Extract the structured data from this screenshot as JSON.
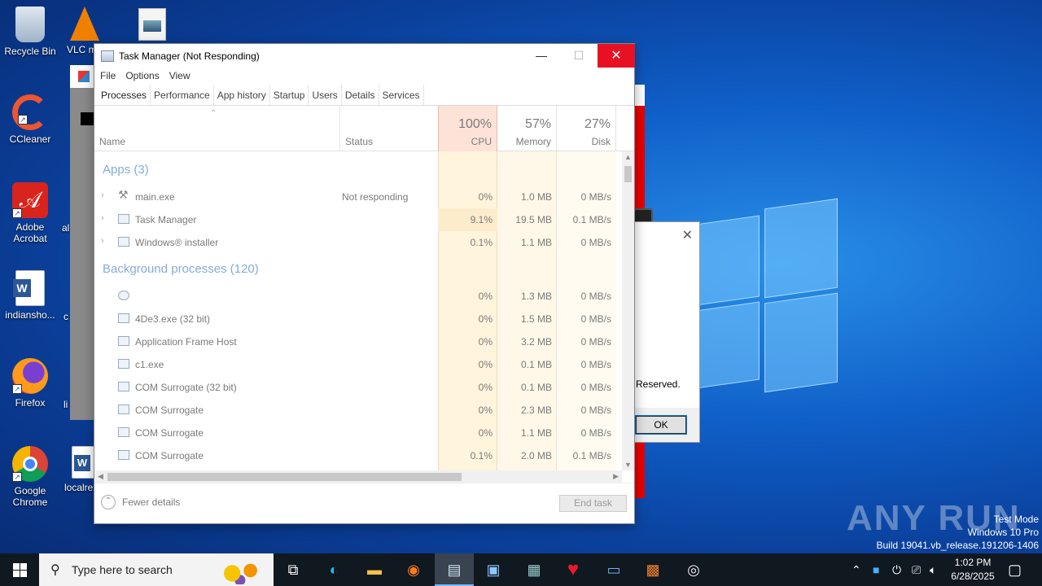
{
  "desktop": {
    "icons": [
      {
        "label": "Recycle Bin"
      },
      {
        "label": "VLC m"
      },
      {
        "label": "CCleaner"
      },
      {
        "label": "Adobe Acrobat"
      },
      {
        "label": "indiansho..."
      },
      {
        "label": "Firefox"
      },
      {
        "label": "Google Chrome"
      },
      {
        "label": "localre"
      },
      {
        "label": "al"
      },
      {
        "label": "c"
      },
      {
        "label": "li"
      }
    ]
  },
  "dialog": {
    "text": "Reserved.",
    "ok_label": "OK",
    "close_glyph": "✕"
  },
  "taskmanager": {
    "title": "Task Manager (Not Responding)",
    "window_controls": {
      "minimize": "—",
      "maximize": "☐",
      "close": "✕"
    },
    "menu": [
      "File",
      "Options",
      "View"
    ],
    "tabs": [
      "Processes",
      "Performance",
      "App history",
      "Startup",
      "Users",
      "Details",
      "Services"
    ],
    "columns": {
      "name": "Name",
      "status": "Status",
      "cpu_pct": "100%",
      "cpu_label": "CPU",
      "mem_pct": "57%",
      "mem_label": "Memory",
      "disk_pct": "27%",
      "disk_label": "Disk"
    },
    "groups": {
      "apps": "Apps (3)",
      "background": "Background processes (120)"
    },
    "apps": [
      {
        "name": "main.exe",
        "status": "Not responding",
        "cpu": "0%",
        "memory": "1.0 MB",
        "disk": "0 MB/s"
      },
      {
        "name": "Task Manager",
        "status": "",
        "cpu": "9.1%",
        "memory": "19.5 MB",
        "disk": "0.1 MB/s"
      },
      {
        "name": "Windows® installer",
        "status": "",
        "cpu": "0.1%",
        "memory": "1.1 MB",
        "disk": "0 MB/s"
      }
    ],
    "background": [
      {
        "name": "",
        "cpu": "0%",
        "memory": "1.3 MB",
        "disk": "0 MB/s"
      },
      {
        "name": "4De3.exe (32 bit)",
        "cpu": "0%",
        "memory": "1.5 MB",
        "disk": "0 MB/s"
      },
      {
        "name": "Application Frame Host",
        "cpu": "0%",
        "memory": "3.2 MB",
        "disk": "0 MB/s"
      },
      {
        "name": "c1.exe",
        "cpu": "0%",
        "memory": "0.1 MB",
        "disk": "0 MB/s"
      },
      {
        "name": "COM Surrogate (32 bit)",
        "cpu": "0%",
        "memory": "0.1 MB",
        "disk": "0 MB/s"
      },
      {
        "name": "COM Surrogate",
        "cpu": "0%",
        "memory": "2.3 MB",
        "disk": "0 MB/s"
      },
      {
        "name": "COM Surrogate",
        "cpu": "0%",
        "memory": "1.1 MB",
        "disk": "0 MB/s"
      },
      {
        "name": "COM Surrogate",
        "cpu": "0.1%",
        "memory": "2.0 MB",
        "disk": "0.1 MB/s"
      }
    ],
    "fewer_details": "Fewer details",
    "end_task": "End task"
  },
  "watermark": {
    "brand": "ANY RUN",
    "line1": "Test Mode",
    "line2": "Windows 10 Pro",
    "line3": "Build 19041.vb_release.191206-1406"
  },
  "taskbar": {
    "search_placeholder": "Type here to search",
    "time": "1:02 PM",
    "date": "6/28/2025"
  }
}
